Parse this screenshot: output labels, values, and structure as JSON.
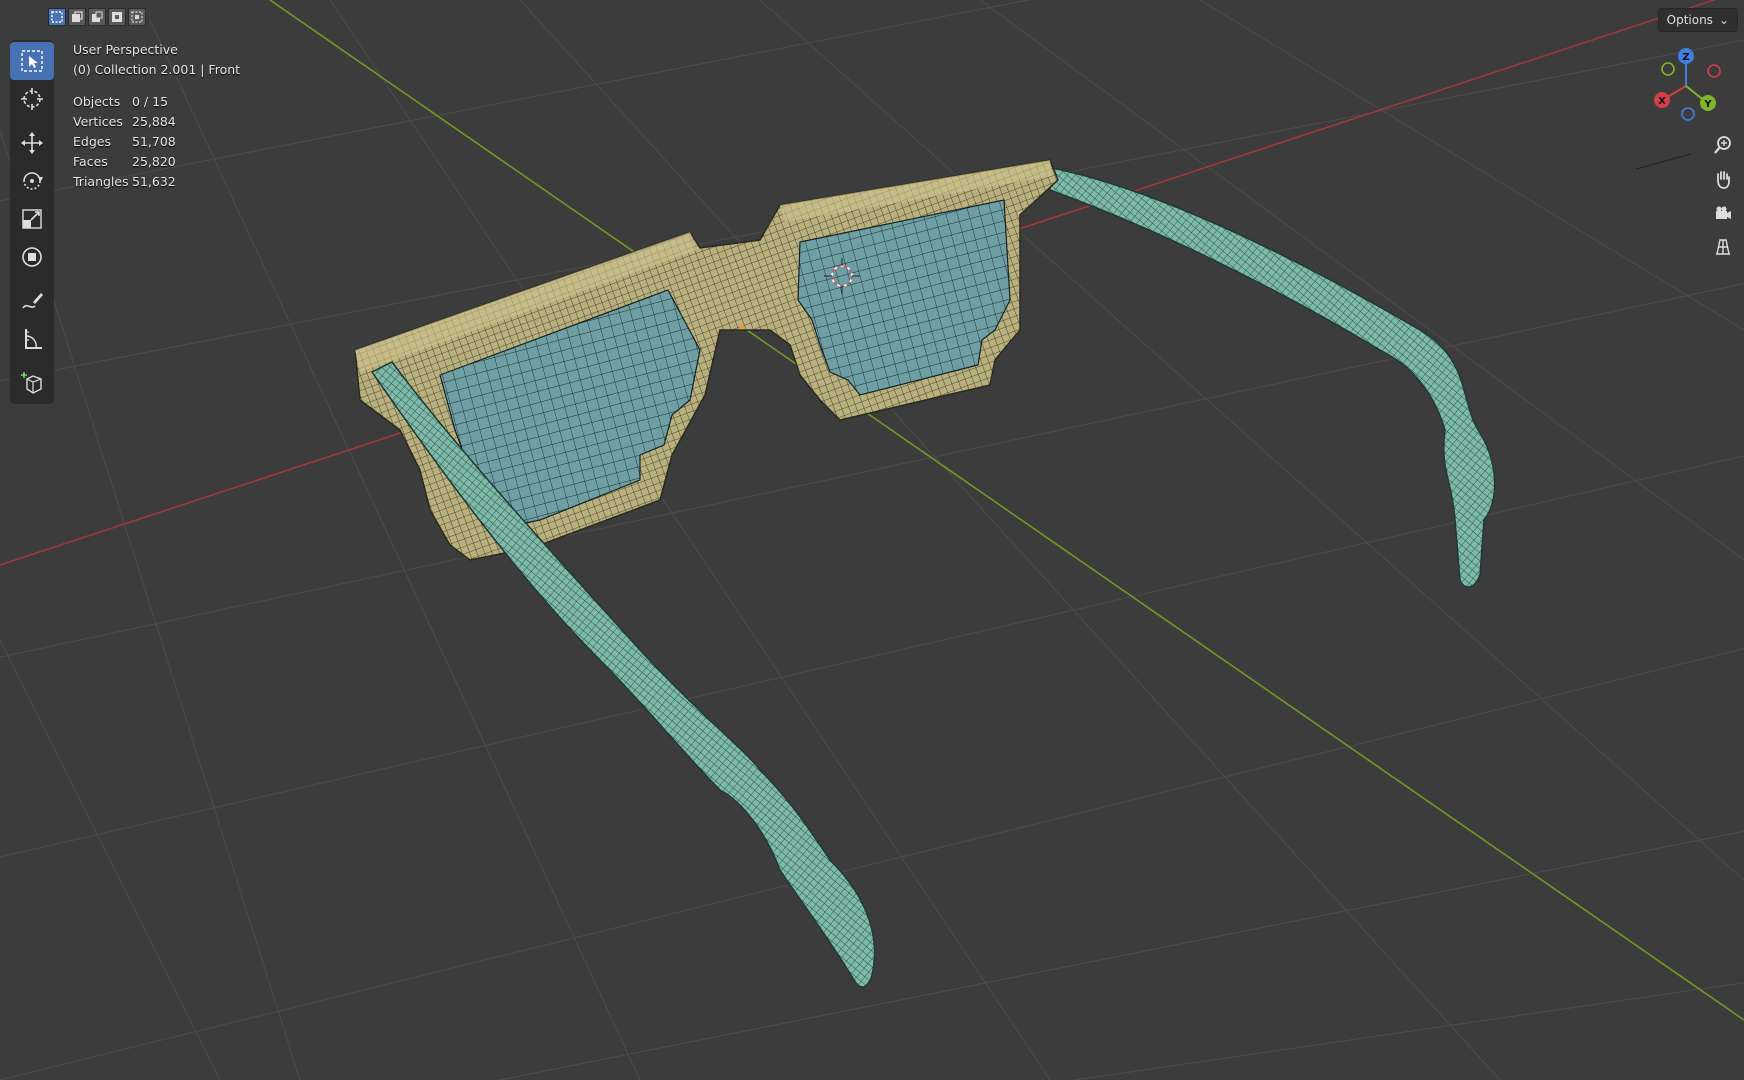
{
  "header": {
    "select_modes": [
      "select-new-icon",
      "select-extend-icon",
      "select-subtract-icon",
      "select-invert-icon",
      "select-intersect-icon"
    ],
    "options_label": "Options"
  },
  "toolbar": {
    "tools": [
      "select-box-icon",
      "cursor-icon",
      "move-icon",
      "rotate-icon",
      "scale-icon",
      "transform-icon",
      "annotate-icon",
      "measure-icon",
      "add-cube-icon"
    ]
  },
  "viewport": {
    "view_name": "User Perspective",
    "collection_line": "(0) Collection 2.001 | Front",
    "stats": [
      {
        "label": "Objects",
        "value": "0 / 15"
      },
      {
        "label": "Vertices",
        "value": "25,884"
      },
      {
        "label": "Edges",
        "value": "51,708"
      },
      {
        "label": "Faces",
        "value": "25,820"
      },
      {
        "label": "Triangles",
        "value": "51,632"
      }
    ]
  },
  "gizmo": {
    "axes": [
      "X",
      "Y",
      "Z"
    ]
  },
  "nav_buttons": [
    "zoom-icon",
    "hand-pan-icon",
    "camera-icon",
    "grid-ortho-icon"
  ],
  "colors": {
    "frame": "#b5ad7a",
    "lens": "#6e9fa3",
    "arm": "#79b8a8",
    "x_axis": "#b53a3a",
    "y_axis": "#7fa32b",
    "z_axis": "#3f7fe0"
  }
}
